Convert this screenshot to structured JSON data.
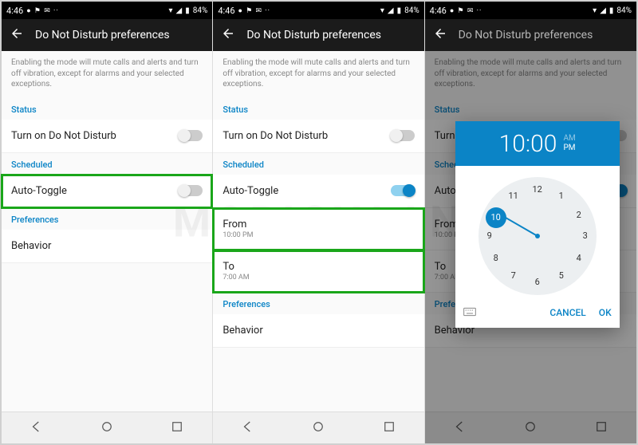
{
  "status": {
    "time": "4:46",
    "battery": "84%"
  },
  "appbar": {
    "title": "Do Not Disturb preferences"
  },
  "info": "Enabling the mode will mute calls and alerts and turn off vibration, except for alarms and your selected exceptions.",
  "sections": {
    "status": "Status",
    "scheduled": "Scheduled",
    "preferences": "Preferences"
  },
  "rows": {
    "turn_on": "Turn on Do Not Disturb",
    "auto_toggle": "Auto-Toggle",
    "from": "From",
    "from_val": "10:00 PM",
    "to": "To",
    "to_val": "7:00 AM",
    "behavior": "Behavior"
  },
  "picker": {
    "time": "10:00",
    "am": "AM",
    "pm": "PM",
    "numbers": [
      "12",
      "1",
      "2",
      "3",
      "4",
      "5",
      "6",
      "7",
      "8",
      "9",
      "10",
      "11"
    ],
    "cancel": "CANCEL",
    "ok": "OK"
  },
  "watermark": "MOBIGYAAN"
}
